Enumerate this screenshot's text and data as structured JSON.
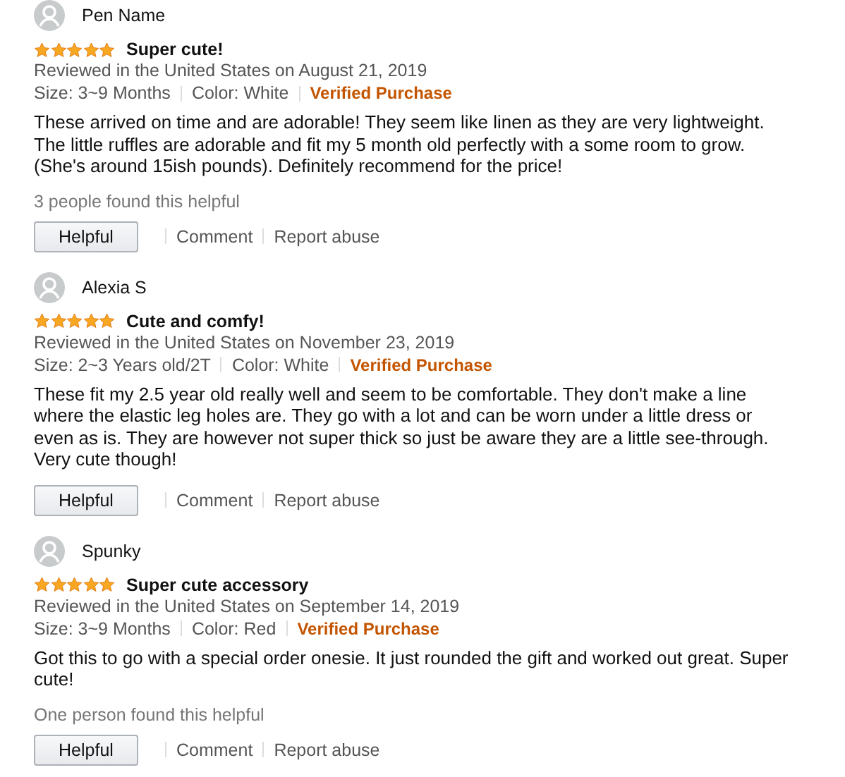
{
  "reviews": [
    {
      "author": "Pen Name",
      "stars": 5,
      "title": "Super cute!",
      "date": "Reviewed in the United States on August 21, 2019",
      "size": "Size: 3~9 Months",
      "variant": "Color: White",
      "verified": "Verified Purchase",
      "body": "These arrived on time and are adorable! They seem like linen as they are very lightweight. The little ruffles are adorable and fit my 5 month old perfectly with a some room to grow. (She's around 15ish pounds). Definitely recommend for the price!",
      "helpful_count": "3 people found this helpful",
      "helpful_button": "Helpful",
      "comment": "Comment",
      "report": "Report abuse"
    },
    {
      "author": "Alexia S",
      "stars": 5,
      "title": "Cute and comfy!",
      "date": "Reviewed in the United States on November 23, 2019",
      "size": "Size: 2~3 Years old/2T",
      "variant": "Color: White",
      "verified": "Verified Purchase",
      "body": "These fit my 2.5 year old really well and seem to be comfortable. They don't make a line where the elastic leg holes are. They go with a lot and can be worn under a little dress or even as is. They are however not super thick so just be aware they are a little see-through. Very cute though!",
      "helpful_button": "Helpful",
      "comment": "Comment",
      "report": "Report abuse"
    },
    {
      "author": "Spunky",
      "stars": 5,
      "title": "Super cute accessory",
      "date": "Reviewed in the United States on September 14, 2019",
      "size": "Size: 3~9 Months",
      "variant": "Color: Red",
      "verified": "Verified Purchase",
      "body": "Got this to go with a special order onesie. It just rounded the gift and worked out great. Super cute!",
      "helpful_count": "One person found this helpful",
      "helpful_button": "Helpful",
      "comment": "Comment",
      "report": "Report abuse"
    }
  ]
}
